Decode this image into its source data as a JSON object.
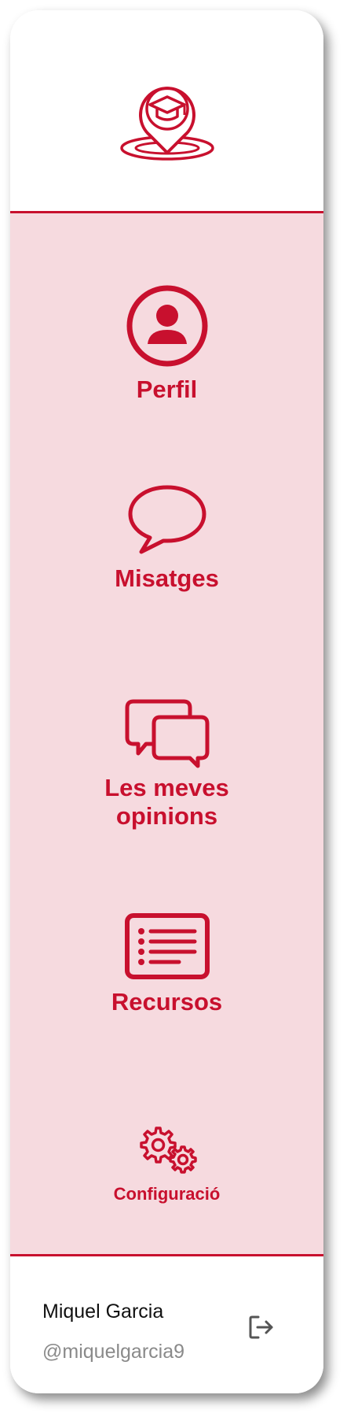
{
  "brand": {
    "logo_icon": "graduation-cap-location-pin-icon",
    "accent_color": "#c8102e",
    "nav_background": "#f6dadf"
  },
  "nav": {
    "items": [
      {
        "label": "Perfil",
        "icon": "user-circle-icon"
      },
      {
        "label": "Misatges",
        "icon": "speech-bubble-icon"
      },
      {
        "label": "Les meves opinions",
        "icon": "chat-bubbles-icon"
      },
      {
        "label": "Recursos",
        "icon": "list-document-icon"
      },
      {
        "label": "Configuració",
        "icon": "gears-icon"
      }
    ]
  },
  "user": {
    "name": "Miquel Garcia",
    "handle": "@miquelgarcia9",
    "logout_icon": "logout-icon"
  }
}
